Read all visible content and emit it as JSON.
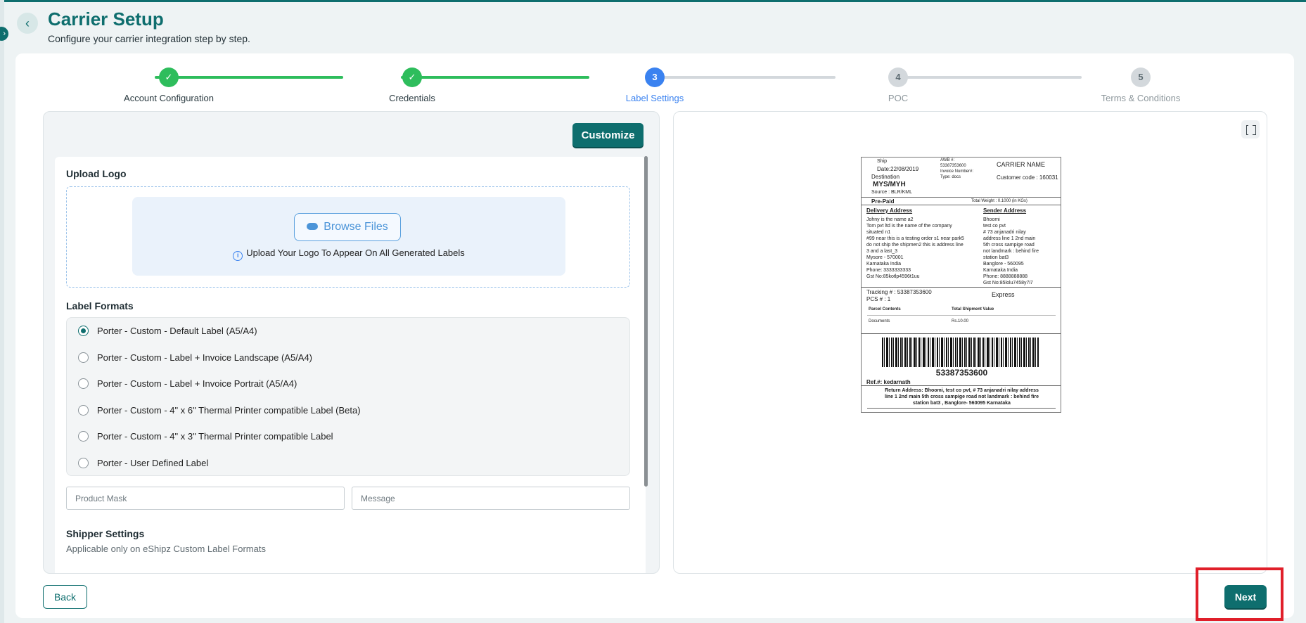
{
  "header": {
    "title": "Carrier Setup",
    "subtitle": "Configure your carrier integration step by step."
  },
  "stepper": {
    "steps": [
      {
        "label": "Account Configuration",
        "number": "1",
        "status": "done"
      },
      {
        "label": "Credentials",
        "number": "2",
        "status": "done"
      },
      {
        "label": "Label Settings",
        "number": "3",
        "status": "active"
      },
      {
        "label": "POC",
        "number": "4",
        "status": "todo"
      },
      {
        "label": "Terms & Conditions",
        "number": "5",
        "status": "todo"
      }
    ],
    "check_glyph": "✓"
  },
  "left_panel": {
    "customize_label": "Customize",
    "upload": {
      "title": "Upload Logo",
      "browse_label": "Browse Files",
      "hint": "Upload Your Logo To Appear On All Generated Labels"
    },
    "formats": {
      "title": "Label Formats",
      "selected_index": 0,
      "options": [
        "Porter - Custom - Default Label (A5/A4)",
        "Porter - Custom - Label + Invoice Landscape (A5/A4)",
        "Porter - Custom - Label + Invoice Portrait (A5/A4)",
        "Porter - Custom - 4\" x 6\" Thermal Printer compatible Label (Beta)",
        "Porter - Custom - 4\" x 3\" Thermal Printer compatible Label",
        "Porter - User Defined Label"
      ]
    },
    "product_mask": {
      "placeholder": "Product Mask",
      "value": ""
    },
    "message": {
      "placeholder": "Message",
      "value": ""
    },
    "shipper": {
      "title": "Shipper Settings",
      "subtitle": "Applicable only on eShipz Custom Label Formats"
    }
  },
  "label_preview": {
    "ship": "Ship",
    "date": "Date:22/08/2019",
    "destination": "Destination",
    "dest_code": "MYS/MYH",
    "source": "Source : BLR/KML",
    "awb_label": "AWB #:",
    "awb_number": "53387353600",
    "invoice_number": "Invoice Number#:",
    "type": "Type: docs",
    "carrier_name": "CARRIER NAME",
    "customer_code": "Customer code : 160031",
    "payment": "Pre-Paid",
    "total_weight": "Total Weight : 0.1000 (in KGs)",
    "delivery_title": "Delivery Address",
    "delivery_lines": [
      "Johny is the name a2",
      "Tom pvt ltd is the name of the company",
      "situated n1",
      "#99 near this is a testing order s1 near park5",
      "do not ship the shipmen2 this is address line",
      "3 and a last_3",
      "Mysore - 570001",
      "Karnataka India",
      "Phone: 3333333333",
      "Gst No:85kotlp4596t1uu"
    ],
    "sender_title": "Sender Address",
    "sender_lines": [
      "Bhoomi",
      "test co pvt",
      "# 73 anjanadri nilay",
      "address line 1 2nd main",
      "5th cross sampige road",
      "not landmark : behind fire",
      "station bat3",
      "Banglore - 560095",
      "Karnataka India",
      "Phone: 8888888888",
      "Gst No:85lolu7458y7i7"
    ],
    "tracking": "Tracking # : 53387353600",
    "pcs": "PCS # : 1",
    "service": "Express",
    "parcel_contents_h": "Parcel Contents",
    "total_value_h": "Total Shipment Value",
    "parcel_contents": "Documents",
    "total_value": "Rs.10.00",
    "barcode_number": "53387353600",
    "ref": "Ref.#: kedarnath",
    "return_address": [
      "Return Address: Bhoomi, test co pvt, # 73 anjanadri nilay address",
      "line 1 2nd main 5th cross sampige road not landmark : behind fire",
      "station bat3 , Banglore- 560095 Karnataka"
    ]
  },
  "footer": {
    "back_label": "Back",
    "next_label": "Next"
  },
  "colors": {
    "brand": "#0e6e6e",
    "done": "#2ebd5c",
    "active": "#3a82f0",
    "highlight": "#e01f2a"
  }
}
